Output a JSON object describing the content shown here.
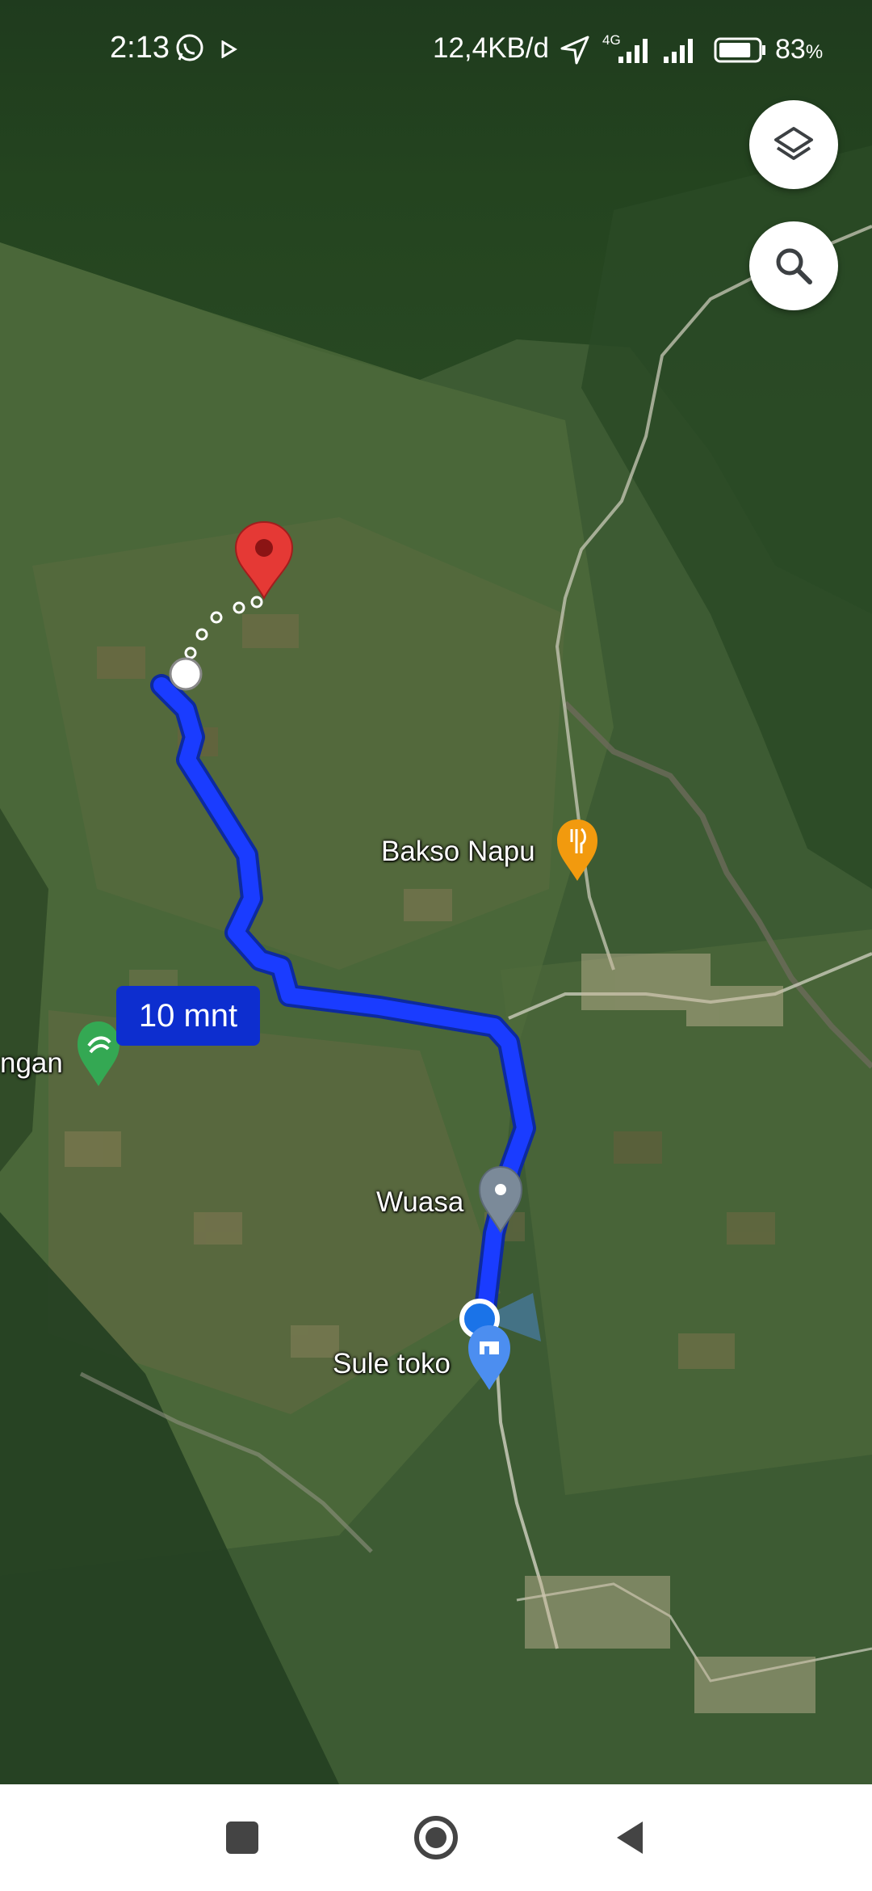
{
  "status_bar": {
    "time": "2:13",
    "network_speed": "12,4KB/d",
    "network_type": "4G",
    "battery_percent": "83",
    "battery_symbol": "%",
    "battery_level": 0.83,
    "icons": [
      "whatsapp-icon",
      "play-icon",
      "location-arrow-icon",
      "signal-icon",
      "battery-icon"
    ]
  },
  "map": {
    "imagery": "satellite",
    "places": {
      "bakso_napu": "Bakso Napu",
      "wuasa": "Wuasa",
      "sule_toko": "Sule toko",
      "partial_left": "ngan"
    },
    "route": {
      "eta_label": "10 mnt",
      "color": "#1a3cff"
    },
    "destination_pin_color": "#e53935",
    "current_location_color": "#1a73e8"
  },
  "controls": {
    "layers_button_icon": "layers-icon",
    "search_button_icon": "search-icon"
  },
  "nav_bar": {
    "buttons": [
      "recents-square-icon",
      "home-circle-icon",
      "back-triangle-icon"
    ]
  }
}
